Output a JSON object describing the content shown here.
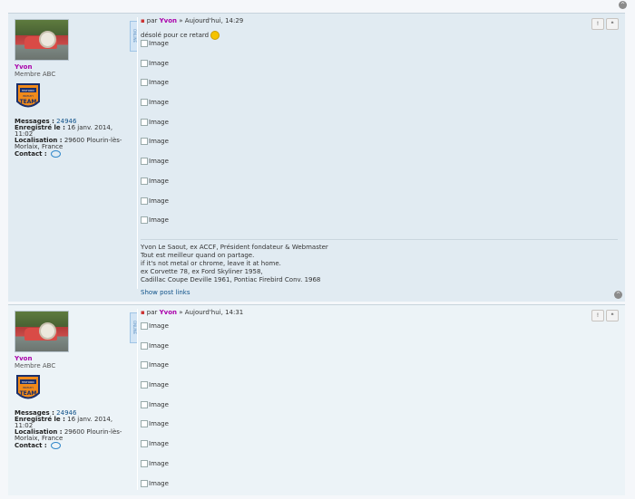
{
  "top_button": "^",
  "posts": [
    {
      "author": "Yvon",
      "rank": "Membre ABC",
      "badge": {
        "top": "HISTORIC",
        "mid": "BREIZH",
        "bottom": "TEAM"
      },
      "messages_label": "Messages :",
      "messages_value": "24946",
      "registered_label": "Enregistré le :",
      "registered_value": "16 janv. 2014, 11:02",
      "location_label": "Localisation :",
      "location_value": "29600 Plourin-lès-Morlaix, France",
      "contact_label": "Contact :",
      "online": "ONLINE",
      "by": "par",
      "time": "» Aujourd'hui, 14:29",
      "text": "désolé pour ce retard",
      "images": [
        "Image",
        "Image",
        "Image",
        "Image",
        "Image",
        "Image",
        "Image",
        "Image",
        "Image",
        "Image"
      ],
      "signature": [
        "Yvon Le Saout, ex ACCF, Président fondateur & Webmaster",
        "Tout est meilleur quand on partage.",
        "if it's not metal or chrome, leave it at home.",
        "ex Corvette 78, ex Ford Skyliner 1958,",
        "Cadillac Coupe Deville 1961, Pontiac Firebird Conv. 1968"
      ],
      "show_links": "Show post links",
      "btn_report": "!",
      "btn_quote": "❝"
    },
    {
      "author": "Yvon",
      "rank": "Membre ABC",
      "badge": {
        "top": "HISTORIC",
        "mid": "BREIZH",
        "bottom": "TEAM"
      },
      "messages_label": "Messages :",
      "messages_value": "24946",
      "registered_label": "Enregistré le :",
      "registered_value": "16 janv. 2014, 11:02",
      "location_label": "Localisation :",
      "location_value": "29600 Plourin-lès-Morlaix, France",
      "contact_label": "Contact :",
      "online": "ONLINE",
      "by": "par",
      "time": "» Aujourd'hui, 14:31",
      "images": [
        "Image",
        "Image",
        "Image",
        "Image",
        "Image",
        "Image",
        "Image",
        "Image",
        "Image"
      ],
      "btn_report": "!",
      "btn_quote": "❝"
    }
  ]
}
